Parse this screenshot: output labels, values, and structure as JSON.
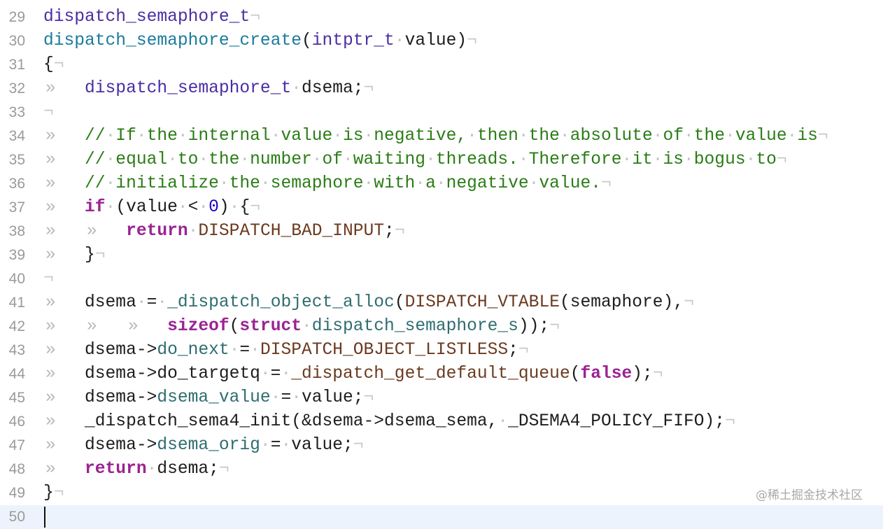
{
  "editor": {
    "eol_marker": "¬",
    "tab_marker": "»",
    "space_marker": "·",
    "current_line": 50,
    "lines": [
      {
        "n": "29",
        "tokens": [
          [
            "t",
            "dispatch_semaphore_t"
          ]
        ]
      },
      {
        "n": "30",
        "tokens": [
          [
            "f",
            "dispatch_semaphore_create"
          ],
          [
            "p",
            "("
          ],
          [
            "t",
            "intptr_t"
          ],
          [
            "p",
            " value)"
          ]
        ]
      },
      {
        "n": "31",
        "tokens": [
          [
            "p",
            "{"
          ]
        ]
      },
      {
        "n": "32",
        "tokens": [
          [
            "tab",
            ""
          ],
          [
            "t",
            "dispatch_semaphore_t"
          ],
          [
            "p",
            " dsema;"
          ]
        ]
      },
      {
        "n": "33",
        "tokens": []
      },
      {
        "n": "34",
        "tokens": [
          [
            "tab",
            ""
          ],
          [
            "c",
            "// If the internal value is negative, then the absolute of the value is"
          ]
        ]
      },
      {
        "n": "35",
        "tokens": [
          [
            "tab",
            ""
          ],
          [
            "c",
            "// equal to the number of waiting threads. Therefore it is bogus to"
          ]
        ]
      },
      {
        "n": "36",
        "tokens": [
          [
            "tab",
            ""
          ],
          [
            "c",
            "// initialize the semaphore with a negative value."
          ]
        ]
      },
      {
        "n": "37",
        "tokens": [
          [
            "tab",
            ""
          ],
          [
            "k",
            "if"
          ],
          [
            "p",
            " (value < "
          ],
          [
            "n",
            "0"
          ],
          [
            "p",
            ") {"
          ]
        ]
      },
      {
        "n": "38",
        "tokens": [
          [
            "tab",
            ""
          ],
          [
            "tab",
            ""
          ],
          [
            "k",
            "return"
          ],
          [
            "p",
            " "
          ],
          [
            "m",
            "DISPATCH_BAD_INPUT"
          ],
          [
            "p",
            ";"
          ]
        ]
      },
      {
        "n": "39",
        "tokens": [
          [
            "tab",
            ""
          ],
          [
            "p",
            "}"
          ]
        ]
      },
      {
        "n": "40",
        "tokens": []
      },
      {
        "n": "41",
        "tokens": [
          [
            "tab",
            ""
          ],
          [
            "p",
            "dsema = "
          ],
          [
            "pf",
            "_dispatch_object_alloc"
          ],
          [
            "p",
            "("
          ],
          [
            "m",
            "DISPATCH_VTABLE"
          ],
          [
            "p",
            "(semaphore),"
          ]
        ]
      },
      {
        "n": "42",
        "tokens": [
          [
            "tab",
            ""
          ],
          [
            "tab",
            ""
          ],
          [
            "tab",
            ""
          ],
          [
            "k",
            "sizeof"
          ],
          [
            "p",
            "("
          ],
          [
            "k",
            "struct"
          ],
          [
            "p",
            " "
          ],
          [
            "pf",
            "dispatch_semaphore_s"
          ],
          [
            "p",
            "));"
          ]
        ]
      },
      {
        "n": "43",
        "tokens": [
          [
            "tab",
            ""
          ],
          [
            "p",
            "dsema->"
          ],
          [
            "pf",
            "do_next"
          ],
          [
            "p",
            " = "
          ],
          [
            "m",
            "DISPATCH_OBJECT_LISTLESS"
          ],
          [
            "p",
            ";"
          ]
        ]
      },
      {
        "n": "44",
        "tokens": [
          [
            "tab",
            ""
          ],
          [
            "p",
            "dsema->do_targetq = "
          ],
          [
            "m",
            "_dispatch_get_default_queue"
          ],
          [
            "p",
            "("
          ],
          [
            "k",
            "false"
          ],
          [
            "p",
            ");"
          ]
        ]
      },
      {
        "n": "45",
        "tokens": [
          [
            "tab",
            ""
          ],
          [
            "p",
            "dsema->"
          ],
          [
            "pf",
            "dsema_value"
          ],
          [
            "p",
            " = value;"
          ]
        ]
      },
      {
        "n": "46",
        "tokens": [
          [
            "tab",
            ""
          ],
          [
            "p",
            "_dispatch_sema4_init(&dsema->dsema_sema, _DSEMA4_POLICY_FIFO);"
          ]
        ]
      },
      {
        "n": "47",
        "tokens": [
          [
            "tab",
            ""
          ],
          [
            "p",
            "dsema->"
          ],
          [
            "pf",
            "dsema_orig"
          ],
          [
            "p",
            " = value;"
          ]
        ]
      },
      {
        "n": "48",
        "tokens": [
          [
            "tab",
            ""
          ],
          [
            "k",
            "return"
          ],
          [
            "p",
            " dsema;"
          ]
        ]
      },
      {
        "n": "49",
        "tokens": [
          [
            "p",
            "}"
          ]
        ]
      },
      {
        "n": "50",
        "tokens": [],
        "no_eol": true
      }
    ]
  },
  "colors": {
    "keyword": "#9b2393",
    "type": "#4b2ea3",
    "function_decl": "#1b7b9e",
    "comment": "#2a7d16",
    "macro": "#6b3a1f",
    "number": "#1c00cf",
    "project_symbol": "#2f6d70",
    "current_line_bg": "#edf3fc"
  },
  "watermark": "@稀土掘金技术社区"
}
